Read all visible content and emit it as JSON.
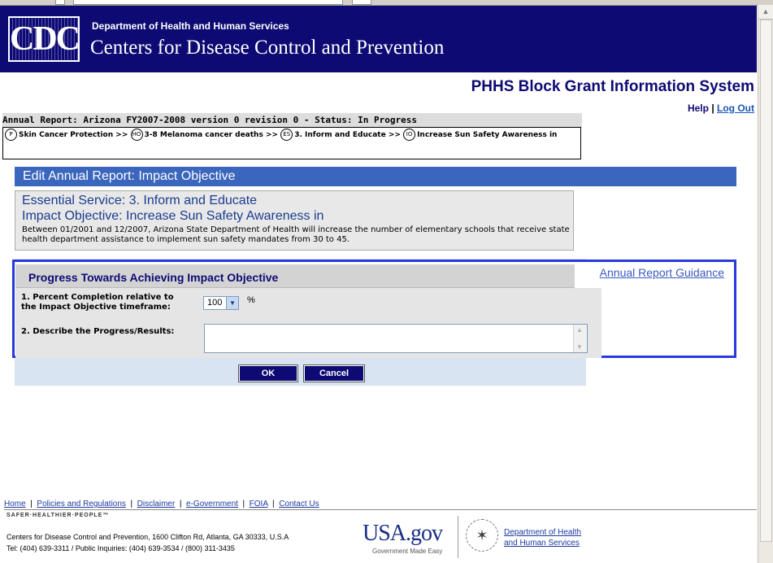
{
  "header": {
    "logo_text": "CDC",
    "dept": "Department of Health and Human Services",
    "agency": "Centers for Disease Control and Prevention"
  },
  "system_title": "PHHS Block Grant Information System",
  "top_links": {
    "help": "Help",
    "sep": "|",
    "logout": "Log Out"
  },
  "report_title": "Annual Report: Arizona FY2007-2008 version 0 revision 0 - Status: In Progress",
  "breadcrumb": {
    "sep": ">>",
    "items": [
      {
        "badge": "P",
        "label": "Skin Cancer Protection"
      },
      {
        "badge": "HO",
        "label": "3-8 Melanoma cancer deaths"
      },
      {
        "badge": "ES",
        "label": "3. Inform and Educate"
      },
      {
        "badge": "IO",
        "label": "Increase Sun Safety Awareness in"
      }
    ]
  },
  "edit_title": "Edit Annual Report: Impact Objective",
  "objective": {
    "essential_service": "Essential Service: 3. Inform and Educate",
    "impact_objective": "Impact Objective: Increase Sun Safety Awareness in",
    "description": "Between 01/2001 and 12/2007, Arizona State Department of Health will increase the number of elementary schools that receive state health department assistance to implement sun safety mandates from 30 to 45."
  },
  "progress": {
    "title": "Progress Towards Achieving Impact Objective",
    "guidance_link": "Annual Report Guidance",
    "percent_label": "1. Percent Completion relative to the Impact Objective timeframe:",
    "percent_value": "100",
    "percent_unit": "%",
    "describe_label": "2. Describe the Progress/Results:",
    "describe_value": ""
  },
  "buttons": {
    "ok": "OK",
    "cancel": "Cancel"
  },
  "footer": {
    "links": [
      "Home",
      "Policies and Regulations",
      "Disclaimer",
      "e-Government",
      "FOIA",
      "Contact Us"
    ],
    "tagline": "SAFER·HEALTHIER·PEOPLE™",
    "address_line1": "Centers for Disease Control and Prevention, 1600 Clifton Rd, Atlanta, GA 30333, U.S.A",
    "address_line2": "Tel: (404) 639-3311 / Public Inquiries: (404) 639-3534 / (800) 311-3435",
    "usagov": "USA.gov",
    "usagov_tag": "Government Made Easy",
    "hhs_link_line1": "Department of Health",
    "hhs_link_line2": "and Human Services"
  },
  "colors": {
    "header_bg": "#0d0a73",
    "edit_bar": "#3b66bd",
    "progress_border": "#2a39dc",
    "panel_bg": "#d9e4f2"
  }
}
